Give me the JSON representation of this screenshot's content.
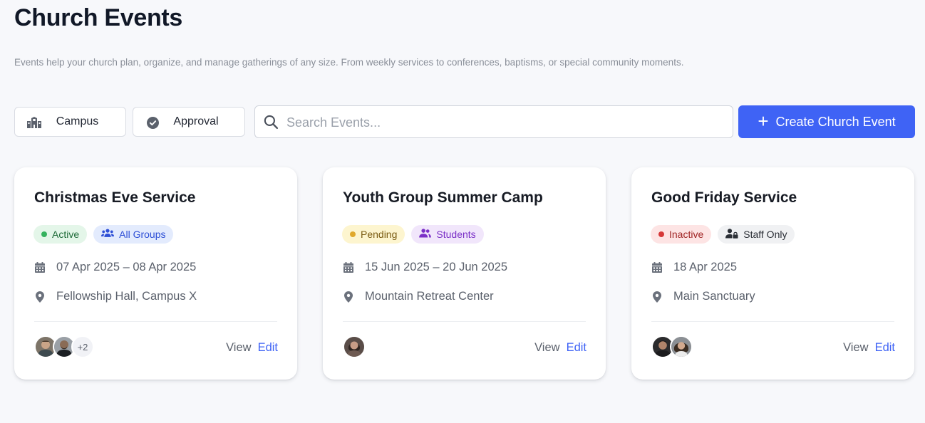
{
  "page": {
    "title": "Church Events",
    "description": "Events help your church plan, organize, and manage gatherings of any size. From weekly services to conferences, baptisms, or special community moments."
  },
  "toolbar": {
    "campus_label": "Campus",
    "campus_icon": "building-icon",
    "approval_label": "Approval",
    "approval_icon": "check-circle-icon",
    "search_placeholder": "Search Events...",
    "search_value": "",
    "create_label": "Create Church Event",
    "accent_color": "#3f63f5"
  },
  "events": [
    {
      "title": "Christmas Eve Service",
      "status": {
        "label": "Active",
        "bg": "#e4f6e9",
        "fg": "#1f6b39",
        "dot": "#35b25e"
      },
      "audience": {
        "label": "All Groups",
        "bg": "#e3ebfd",
        "fg": "#2e4fd6",
        "icon": "users-icon"
      },
      "date": "07 Apr 2025 – 08 Apr 2025",
      "location": "Fellowship Hall, Campus X",
      "extra_attendees": "+2",
      "view_label": "View",
      "edit_label": "Edit"
    },
    {
      "title": "Youth Group Summer Camp",
      "status": {
        "label": "Pending",
        "bg": "#fdf5cf",
        "fg": "#7a5b12",
        "dot": "#e0a82b"
      },
      "audience": {
        "label": "Students",
        "bg": "#f1e6fb",
        "fg": "#7b30c7",
        "icon": "users-icon"
      },
      "date": "15 Jun 2025 – 20 Jun 2025",
      "location": "Mountain Retreat Center",
      "view_label": "View",
      "edit_label": "Edit"
    },
    {
      "title": "Good Friday Service",
      "status": {
        "label": "Inactive",
        "bg": "#fde4e4",
        "fg": "#a12525",
        "dot": "#d63838"
      },
      "audience": {
        "label": "Staff Only",
        "bg": "#f0f1f3",
        "fg": "#2b2f36",
        "icon": "user-lock-icon"
      },
      "date": "18 Apr 2025",
      "location": "Main Sanctuary",
      "view_label": "View",
      "edit_label": "Edit"
    }
  ]
}
